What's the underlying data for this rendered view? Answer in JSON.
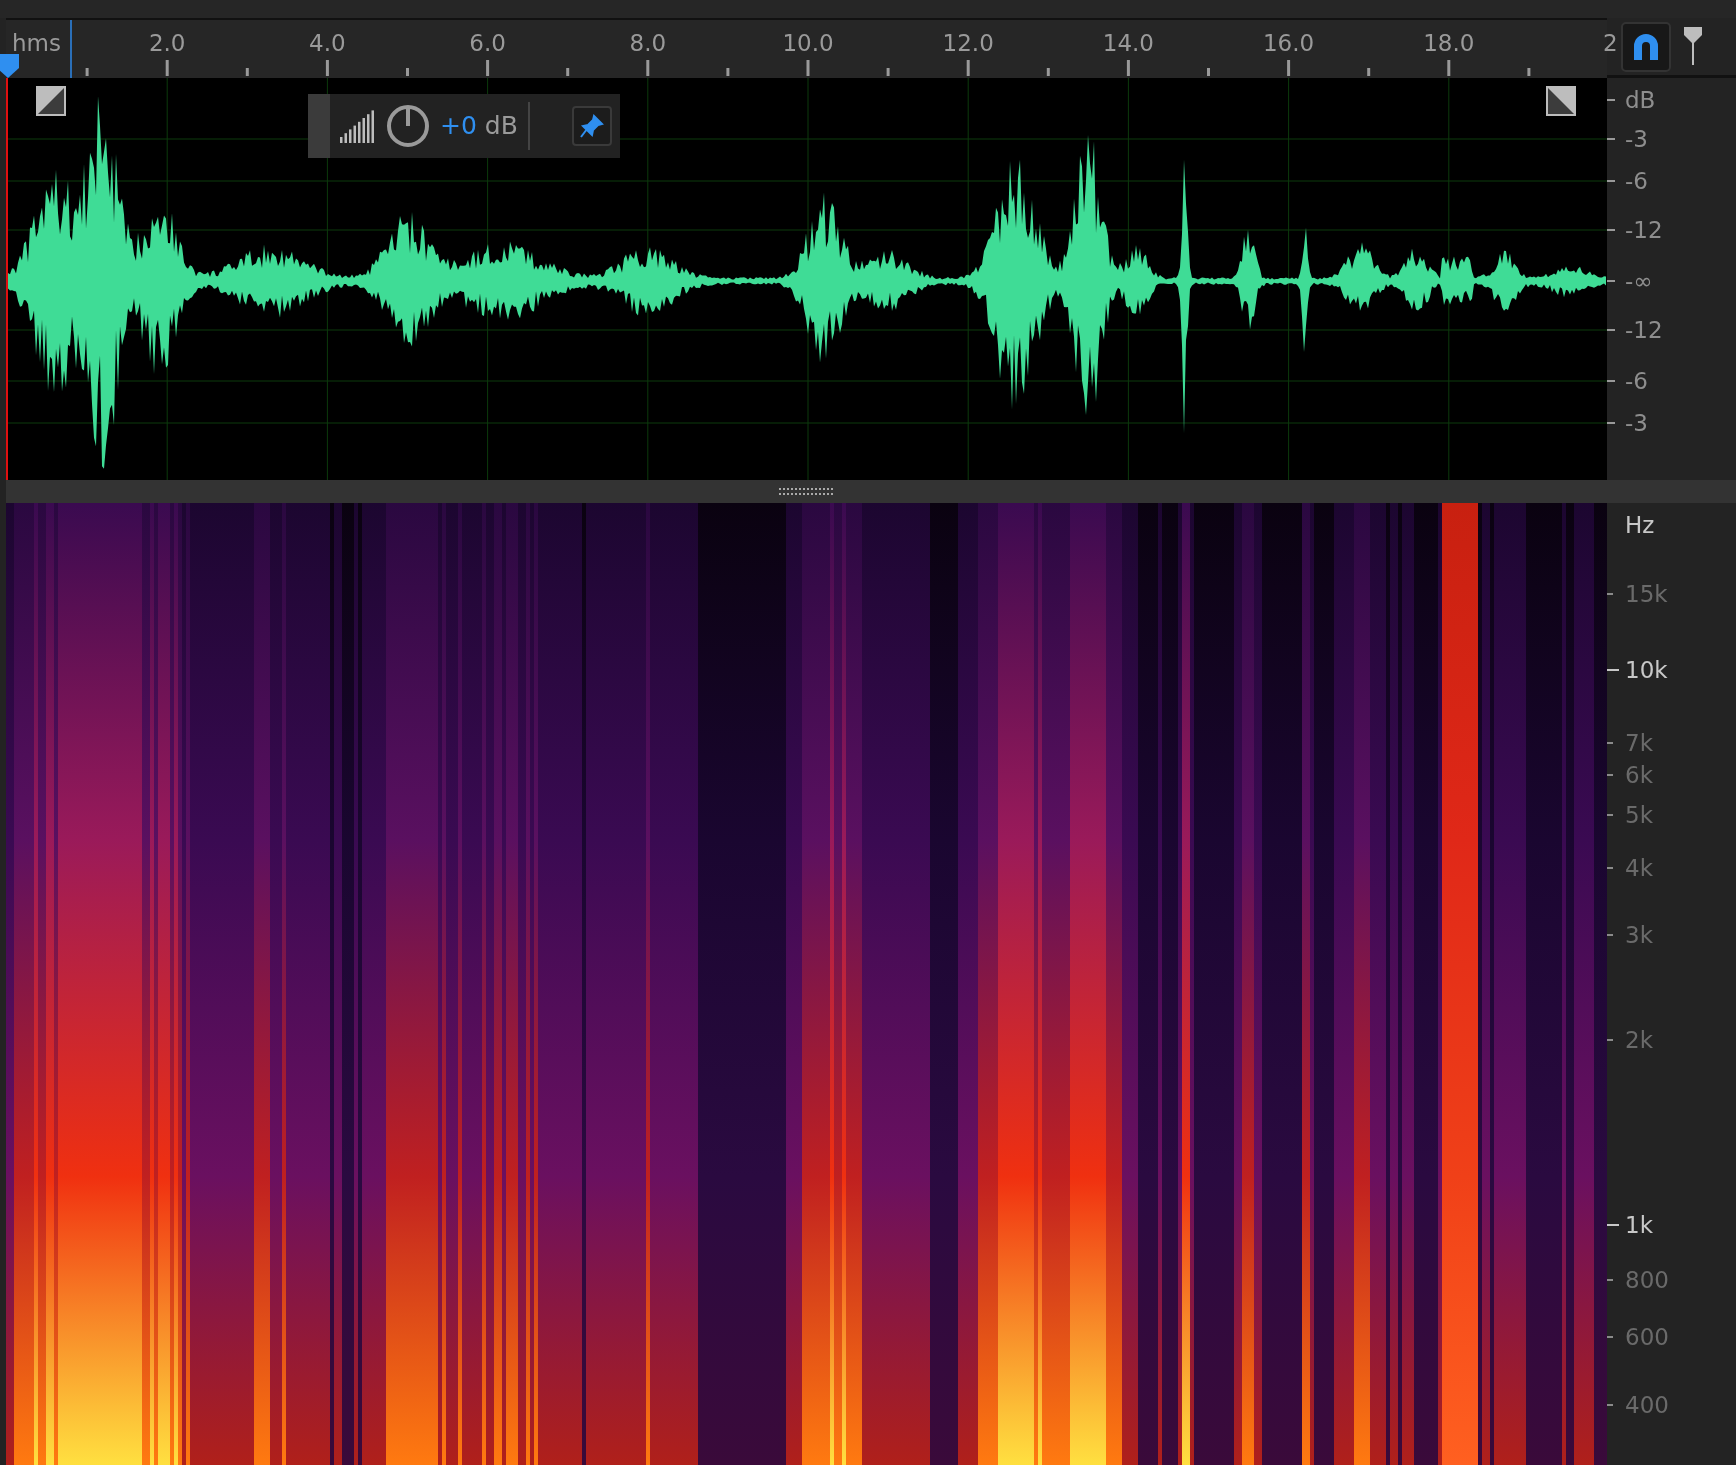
{
  "ruler": {
    "unit": "hms",
    "labels": [
      "2.0",
      "4.0",
      "6.0",
      "8.0",
      "10.0",
      "12.0",
      "14.0",
      "16.0",
      "18.0",
      "2"
    ]
  },
  "toolbar": {
    "snap": {
      "on": true
    }
  },
  "hud": {
    "value": "+0",
    "unit": "dB"
  },
  "amplitude_axis": {
    "labels": [
      "dB",
      "-3",
      "-6",
      "-12",
      "-∞",
      "-12",
      "-6",
      "-3"
    ]
  },
  "frequency_axis": {
    "labels": [
      {
        "text": "Hz",
        "major": true
      },
      {
        "text": "15k",
        "major": false
      },
      {
        "text": "10k",
        "major": true
      },
      {
        "text": "7k",
        "major": false
      },
      {
        "text": "6k",
        "major": false
      },
      {
        "text": "5k",
        "major": false
      },
      {
        "text": "4k",
        "major": false
      },
      {
        "text": "3k",
        "major": false
      },
      {
        "text": "2k",
        "major": false
      },
      {
        "text": "1k",
        "major": true
      },
      {
        "text": "800",
        "major": false
      },
      {
        "text": "600",
        "major": false
      },
      {
        "text": "400",
        "major": false
      }
    ]
  }
}
